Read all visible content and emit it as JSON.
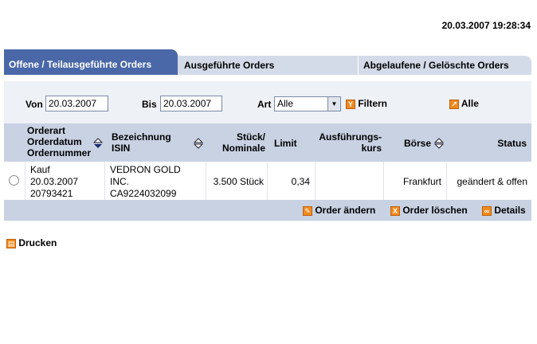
{
  "header": {
    "datetime": "20.03.2007 19:28:34"
  },
  "tabs": [
    {
      "label": "Offene / Teilausgeführte Orders",
      "active": true
    },
    {
      "label": "Ausgeführte Orders",
      "active": false
    },
    {
      "label": "Abgelaufene / Gelöschte Orders",
      "active": false
    }
  ],
  "filter": {
    "von_label": "Von",
    "von_value": "20.03.2007",
    "bis_label": "Bis",
    "bis_value": "20.03.2007",
    "art_label": "Art",
    "art_value": "Alle",
    "filter_label": "Filtern",
    "all_label": "Alle"
  },
  "table": {
    "headers": {
      "orderart": "Orderart",
      "orderdatum": "Orderdatum",
      "ordernummer": "Ordernummer",
      "bezeichnung": "Bezeichnung",
      "isin": "ISIN",
      "stueck": "Stück/",
      "nominale": "Nominale",
      "limit": "Limit",
      "ausf1": "Ausführungs-",
      "ausf2": "kurs",
      "boerse": "Börse",
      "status": "Status"
    },
    "row": {
      "art": "Kauf",
      "datum": "20.03.2007",
      "nummer": "20793421",
      "bez1": "VEDRON GOLD",
      "bez2": "INC.",
      "isin": "CA9224032099",
      "stueck": "3.500 Stück",
      "limit": "0,34",
      "kurs": "",
      "boerse": "Frankfurt",
      "status": "geändert & offen"
    }
  },
  "actions": {
    "change": "Order ändern",
    "delete": "Order löschen",
    "details": "Details"
  },
  "print": {
    "label": "Drucken"
  },
  "colors": {
    "tab_active": "#4a68a8",
    "tab_inactive": "#d4dbe8",
    "header_bg": "#c8d2e3",
    "panel_bg": "#eef1f6",
    "icon_orange": "#f08a1e"
  }
}
